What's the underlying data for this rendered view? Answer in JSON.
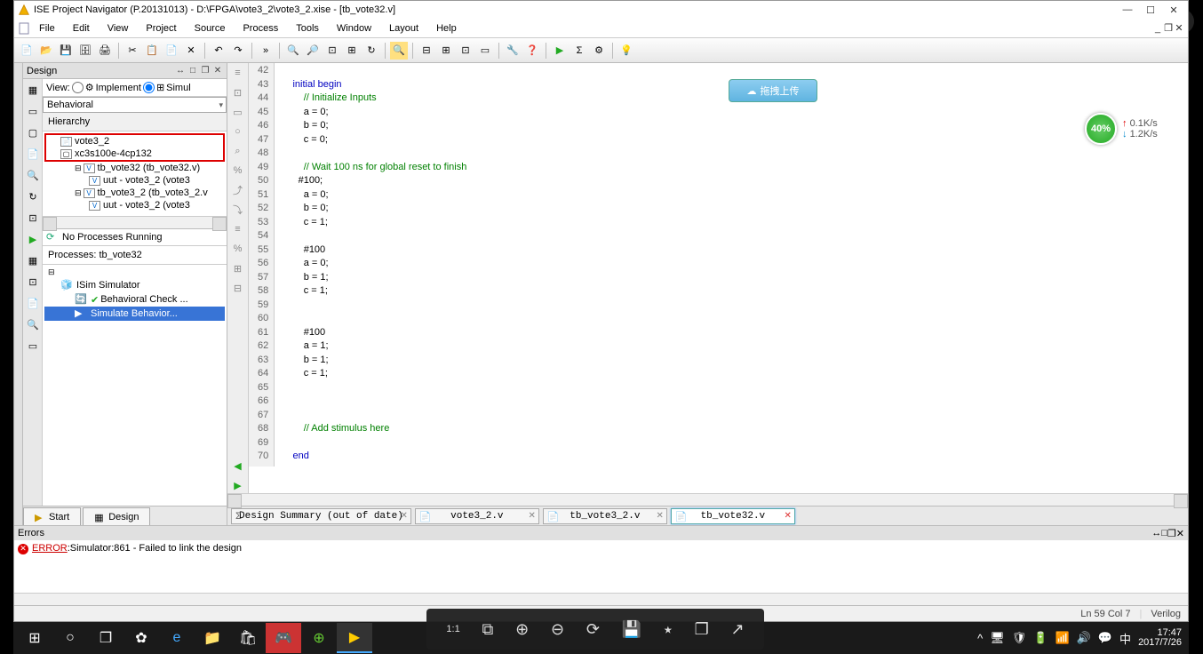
{
  "window": {
    "title": "ISE Project Navigator (P.20131013) - D:\\FPGA\\vote3_2\\vote3_2.xise - [tb_vote32.v]",
    "min_tip": "Minimize",
    "max_tip": "Maximize",
    "close_tip": "Close"
  },
  "menu": {
    "items": [
      "File",
      "Edit",
      "View",
      "Project",
      "Source",
      "Process",
      "Tools",
      "Window",
      "Layout",
      "Help"
    ]
  },
  "design": {
    "panel_title": "Design",
    "view_label": "View:",
    "impl_label": "Implement",
    "sim_label": "Simul",
    "combo_value": "Behavioral",
    "hierarchy_label": "Hierarchy",
    "tree": [
      {
        "label": "vote3_2",
        "indent": 16,
        "icon": "📄"
      },
      {
        "label": "xc3s100e-4cp132",
        "indent": 16,
        "icon": "▢"
      },
      {
        "label": "tb_vote32 (tb_vote32.v)",
        "indent": 34,
        "icon": "V",
        "exp": "⊟"
      },
      {
        "label": "uut - vote3_2 (vote3",
        "indent": 50,
        "icon": "V"
      },
      {
        "label": "tb_vote3_2 (tb_vote3_2.v",
        "indent": 34,
        "icon": "V",
        "exp": "⊟"
      },
      {
        "label": "uut - vote3_2 (vote3",
        "indent": 50,
        "icon": "V"
      }
    ],
    "no_proc": "No Processes Running",
    "proc_label": "Processes: tb_vote32",
    "proc_tree": [
      {
        "label": "ISim Simulator",
        "icon": "🧊",
        "cls": "pn"
      },
      {
        "label": "Behavioral Check ...",
        "icon": "✔",
        "cls": "pn pn2",
        "ok": true
      },
      {
        "label": "Simulate Behavior...",
        "icon": "▶",
        "cls": "pn pn2 sel"
      }
    ],
    "bottom_tabs": [
      {
        "label": "Start",
        "icon": "▶"
      },
      {
        "label": "Design",
        "icon": "▦"
      }
    ]
  },
  "editor": {
    "lines_start": 42,
    "lines_end": 70,
    "code": [
      {
        "t": ""
      },
      {
        "t": "    ",
        "kw": "initial begin"
      },
      {
        "t": "        ",
        "cm": "// Initialize Inputs"
      },
      {
        "t": "        a = 0;"
      },
      {
        "t": "        b = 0;"
      },
      {
        "t": "        c = 0;"
      },
      {
        "t": ""
      },
      {
        "t": "        ",
        "cm": "// Wait 100 ns for global reset to finish"
      },
      {
        "t": "      #100;"
      },
      {
        "t": "        a = 0;"
      },
      {
        "t": "        b = 0;"
      },
      {
        "t": "        c = 1;"
      },
      {
        "t": ""
      },
      {
        "t": "        #100"
      },
      {
        "t": "        a = 0;"
      },
      {
        "t": "        b = 1;"
      },
      {
        "t": "        c = 1;"
      },
      {
        "t": ""
      },
      {
        "t": ""
      },
      {
        "t": "        #100"
      },
      {
        "t": "        a = 1;"
      },
      {
        "t": "        b = 1;"
      },
      {
        "t": "        c = 1;"
      },
      {
        "t": ""
      },
      {
        "t": ""
      },
      {
        "t": ""
      },
      {
        "t": "        ",
        "cm": "// Add stimulus here"
      },
      {
        "t": ""
      },
      {
        "t": "    ",
        "kw": "end"
      }
    ],
    "tabs": [
      {
        "label": "Design Summary (out of date)",
        "active": false,
        "close": "x",
        "sigma": true
      },
      {
        "label": "vote3_2.v",
        "active": false,
        "close": "x"
      },
      {
        "label": "tb_vote3_2.v",
        "active": false,
        "close": "x"
      },
      {
        "label": "tb_vote32.v",
        "active": true,
        "close": "x",
        "closeRed": true
      }
    ],
    "upload_label": "拖拽上传",
    "speed": {
      "pct": "40%",
      "up": "0.1K/s",
      "down": "1.2K/s"
    }
  },
  "errors": {
    "title": "Errors",
    "line_prefix": "ERROR",
    "line_rest": ":Simulator:861 - Failed to link the design"
  },
  "status": {
    "pos": "Ln 59 Col 7",
    "lang": "Verilog"
  },
  "viewer": {
    "zoom": "1:1"
  },
  "clock": {
    "time": "17:47",
    "date": "2017/7/26"
  }
}
